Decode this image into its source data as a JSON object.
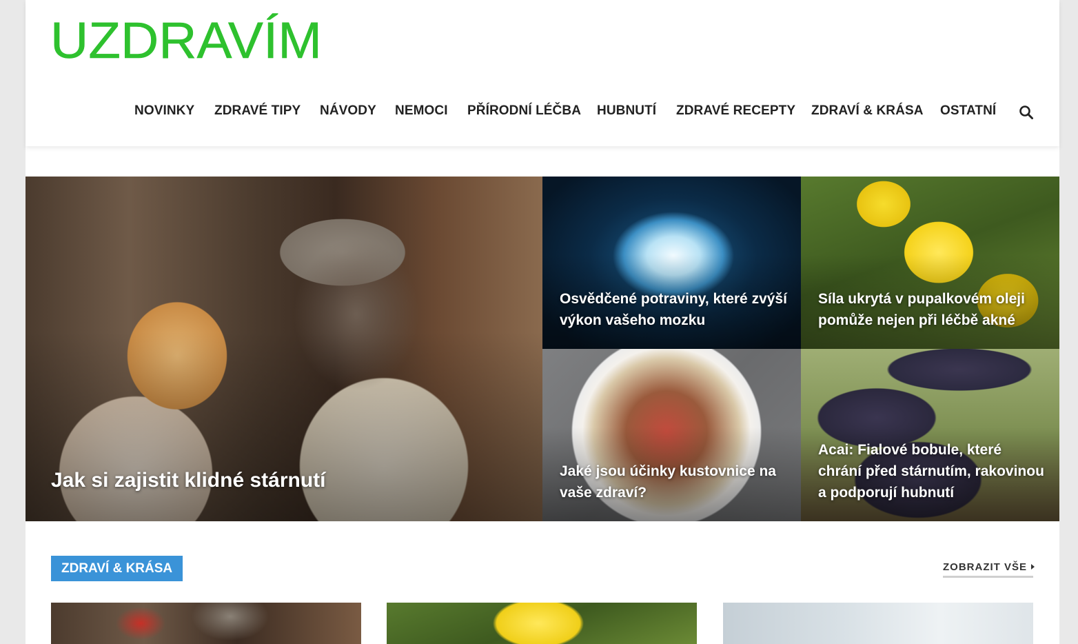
{
  "site": {
    "logo_text": "UZDRAVÍM",
    "brand_color": "#2ec12e"
  },
  "nav": {
    "items": [
      {
        "label": "NOVINKY"
      },
      {
        "label": "ZDRAVÉ TIPY"
      },
      {
        "label": "NÁVODY"
      },
      {
        "label": "NEMOCI"
      },
      {
        "label": "PŘÍRODNÍ LÉČBA"
      },
      {
        "label": "HUBNUTÍ"
      },
      {
        "label": "ZDRAVÉ RECEPTY"
      },
      {
        "label": "ZDRAVÍ & KRÁSA"
      },
      {
        "label": "OSTATNÍ"
      }
    ],
    "search_icon": "search-icon"
  },
  "hero": {
    "main": {
      "title": "Jak si zajistit klidné stárnutí"
    },
    "tiles": [
      {
        "title": "Osvědčené potraviny, které zvýší výkon vašeho mozku"
      },
      {
        "title": "Síla ukrytá v pupalkovém oleji pomůže nejen při léčbě akné"
      },
      {
        "title": "Jaké jsou účinky kustovnice na vaše zdraví?"
      },
      {
        "title": "Acai: Fialové bobule, které chrání před stárnutím, rakovinou a podporují hubnutí"
      }
    ]
  },
  "section": {
    "badge": "ZDRAVÍ & KRÁSA",
    "badge_color": "#3a93d8",
    "see_all": "ZOBRAZIT VŠE"
  }
}
